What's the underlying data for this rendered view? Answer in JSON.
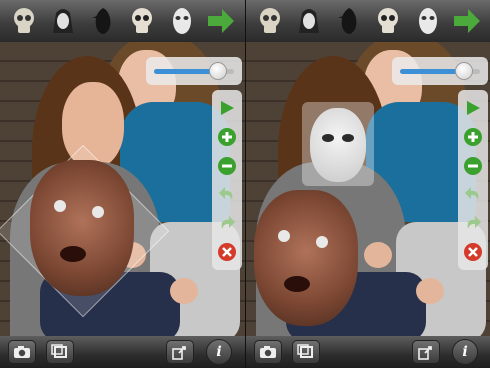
{
  "app": {
    "top_toolbar": {
      "masks": [
        "skull-icon",
        "hooded-face-icon",
        "raven-icon",
        "skull-icon",
        "hockey-mask-icon"
      ],
      "next_icon": "arrow-right-icon"
    },
    "size_slider": {
      "value": 0.8
    },
    "side_toolbar": {
      "tools": [
        "play-icon",
        "plus-icon",
        "minus-icon",
        "undo-icon",
        "redo-icon",
        "close-icon"
      ]
    },
    "bottom_toolbar": {
      "camera_icon": "camera-icon",
      "crop_icon": "crop-icon",
      "share_icon": "share-icon",
      "info_label": "i"
    },
    "colors": {
      "green": "#3aa12f",
      "red": "#d53a2a",
      "blue": "#3d8fd6"
    }
  }
}
